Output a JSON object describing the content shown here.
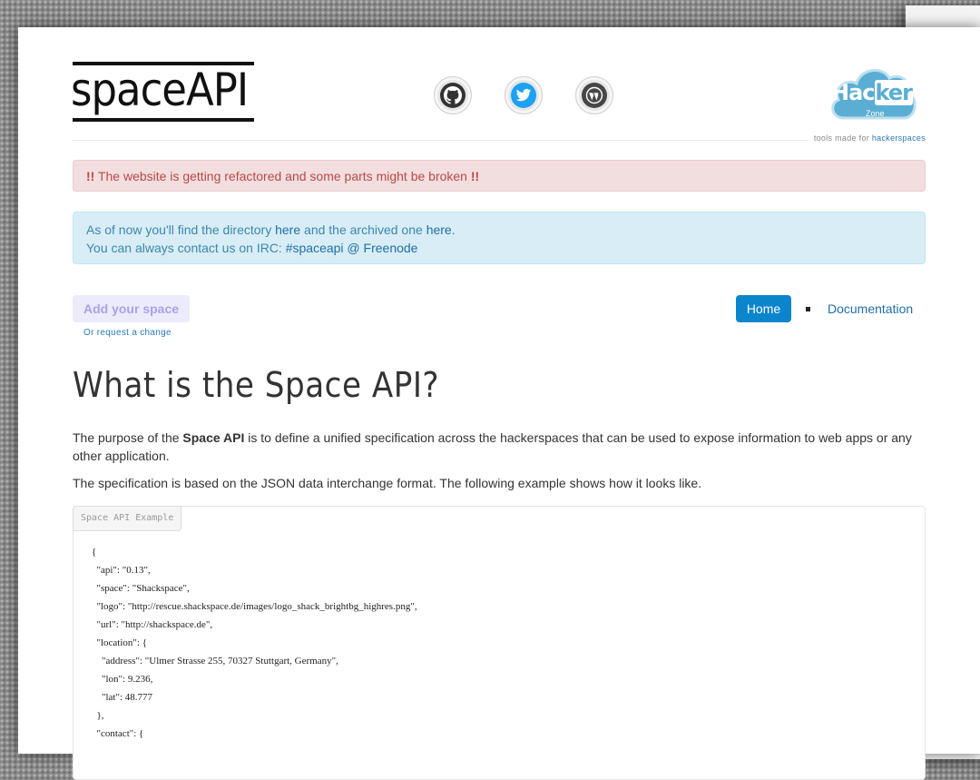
{
  "header": {
    "logo_text": "spaceAPI",
    "social": [
      {
        "icon": "github-icon",
        "color": "#333333"
      },
      {
        "icon": "twitter-icon",
        "color": "#1da1f2"
      },
      {
        "icon": "wordpress-icon",
        "color": "#464646"
      }
    ],
    "hackerzone": {
      "title_a": "Hac",
      "title_b": "ker",
      "zone": "Zone"
    },
    "tagline_prefix": "tools made for ",
    "tagline_link": "hackerspaces"
  },
  "alerts": {
    "danger": {
      "marks": "!!",
      "text": " The website is getting refactored and some parts might be broken "
    },
    "info": {
      "line1_a": "As of now you'll find the directory ",
      "line1_link1": "here",
      "line1_b": " and the archived one ",
      "line1_link2": "here",
      "line1_c": ".",
      "line2_a": "You can always contact us on IRC: ",
      "line2_link": "#spaceapi @ Freenode"
    }
  },
  "actions": {
    "add_space": "Add your space",
    "request_change": "Or request a change"
  },
  "nav": {
    "home": "Home",
    "documentation": "Documentation"
  },
  "main": {
    "title": "What is the Space API?",
    "p1_a": "The purpose of the ",
    "p1_bold": "Space API",
    "p1_b": " is to define a unified specification across the hackerspaces that can be used to expose information to web apps or any other application.",
    "p2": "The specification is based on the JSON data interchange format. The following example shows how it looks like."
  },
  "example": {
    "label": "Space API Example",
    "code": "{\n  \"api\": \"0.13\",\n  \"space\": \"Shackspace\",\n  \"logo\": \"http://rescue.shackspace.de/images/logo_shack_brightbg_highres.png\",\n  \"url\": \"http://shackspace.de\",\n  \"location\": {\n    \"address\": \"Ulmer Strasse 255, 70327 Stuttgart, Germany\",\n    \"lon\": 9.236,\n    \"lat\": 48.777\n  },\n  \"contact\": {"
  },
  "colors": {
    "accent": "#0b85cc",
    "danger_text": "#b94a48",
    "info_text": "#3a87ad"
  }
}
